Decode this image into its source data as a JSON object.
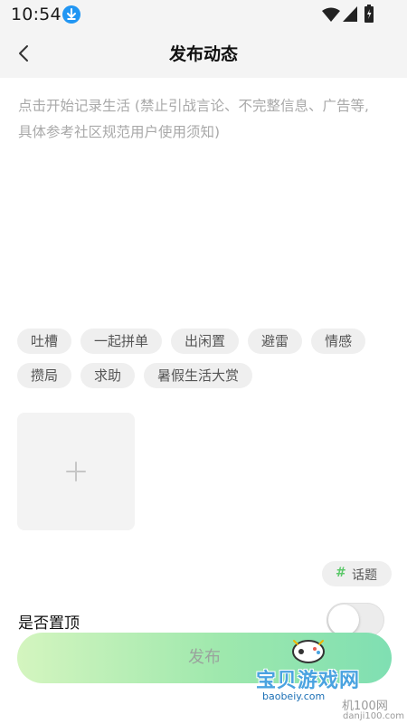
{
  "status_bar": {
    "time": "10:54",
    "icons": [
      "download-icon",
      "wifi-icon",
      "signal-icon",
      "battery-icon"
    ]
  },
  "header": {
    "title": "发布动态",
    "back_icon": "chevron-left-icon"
  },
  "post": {
    "placeholder": "点击开始记录生活 (禁止引战言论、不完整信息、广告等, 具体参考社区规范用户使用须知)",
    "value": ""
  },
  "tags": {
    "row1": [
      "吐槽",
      "一起拼单",
      "出闲置",
      "避雷",
      "情感"
    ],
    "row2": [
      "攒局",
      "求助",
      "暑假生活大赏"
    ]
  },
  "image_upload": {
    "icon": "plus-icon"
  },
  "topic": {
    "icon": "hash-icon",
    "label": "话题"
  },
  "pin": {
    "label": "是否置顶",
    "enabled": false
  },
  "publish": {
    "label": "发布"
  },
  "watermark": {
    "title": "宝贝游戏网",
    "site": "baobeiy.com",
    "partner": "机100网",
    "partner_site": "danji100.com"
  },
  "colors": {
    "accent_green": "#5cc86a",
    "publish_gradient_start": "#d4f5bf",
    "publish_gradient_end": "#7fdfb2",
    "tag_background": "#efefef"
  }
}
